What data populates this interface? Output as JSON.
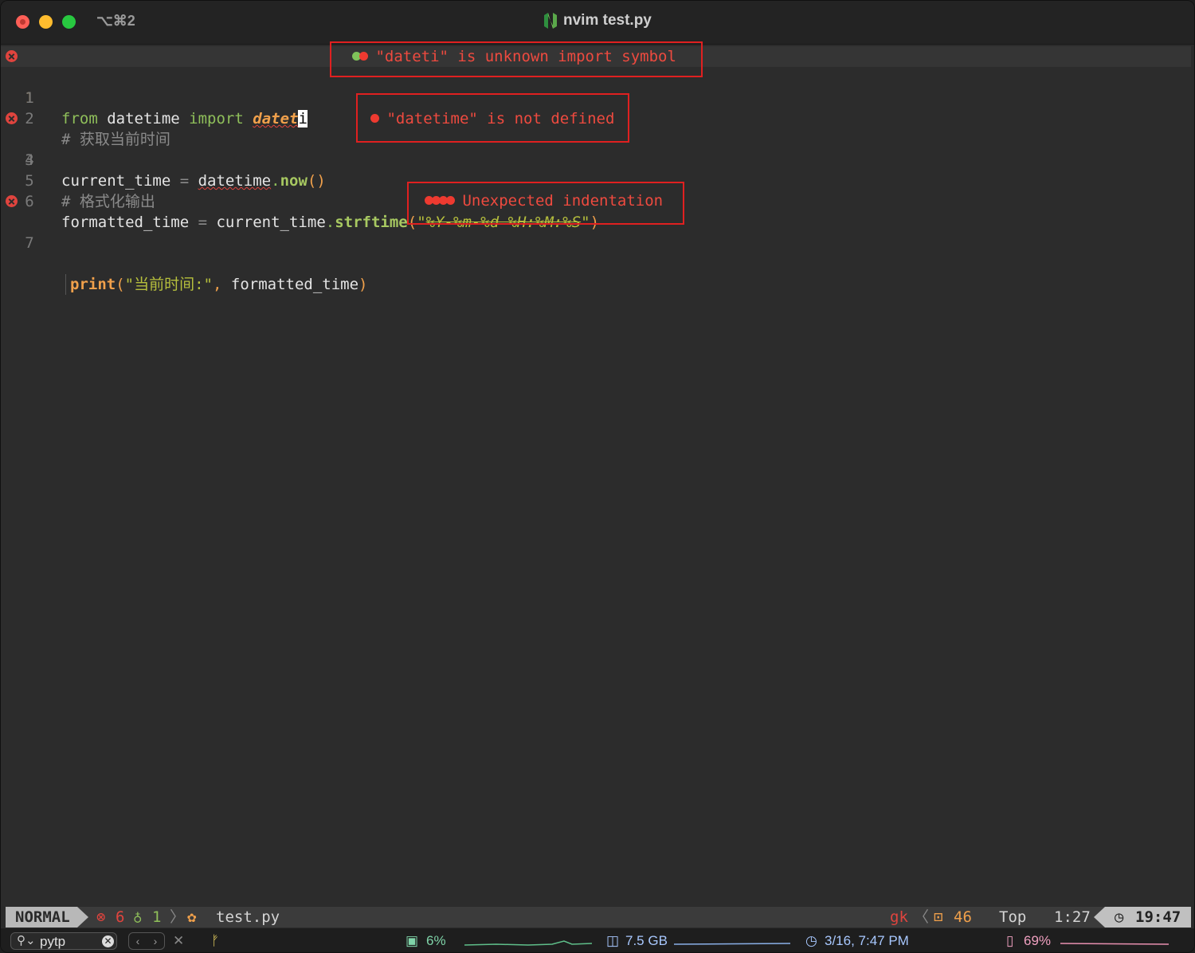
{
  "window": {
    "shortcut": "⌥⌘2",
    "title": "nvim test.py"
  },
  "editor": {
    "lines": [
      {
        "num": "1",
        "tokens": [
          "from",
          " datetime ",
          "import",
          " ",
          "datet",
          "i"
        ]
      },
      {
        "num": "1",
        "tokens": []
      },
      {
        "num": "2",
        "tokens": [
          "# 获取当前时间"
        ]
      },
      {
        "num": "3",
        "tokens": [
          "current_time",
          " = ",
          "datetime",
          ".",
          "now",
          "()"
        ]
      },
      {
        "num": "4",
        "tokens": []
      },
      {
        "num": "5",
        "tokens": [
          "# 格式化输出"
        ]
      },
      {
        "num": "6",
        "tokens": [
          "formatted_time",
          " = ",
          "current_time",
          ".",
          "strftime",
          "(",
          "\"",
          "%Y-%m-%d %H:%M:%S",
          "\"",
          ")"
        ]
      },
      {
        "num": "7",
        "tokens": [
          "print",
          "(",
          "\"当前时间:\"",
          ", ",
          "formatted_time",
          ")"
        ]
      }
    ],
    "diagnostics": [
      {
        "text": "\"dateti\" is unknown import symbol",
        "line": "1"
      },
      {
        "text": "\"datetime\" is not defined",
        "line": "3"
      },
      {
        "text": "Unexpected indentation",
        "line": "7"
      }
    ]
  },
  "statusline": {
    "mode": "NORMAL",
    "errors": "6",
    "hints": "1",
    "filename": "test.py",
    "branch": "gk",
    "count": "46",
    "position": "Top",
    "cursor": "1:27",
    "clock": "19:47"
  },
  "bottombar": {
    "search_value": "pytp",
    "cpu": "6%",
    "memory": "7.5 GB",
    "datetime": "3/16, 7:47 PM",
    "battery": "69%"
  },
  "colors": {
    "error": "#e0443e",
    "keyword": "#8fbf5a",
    "accent": "#f0a04b"
  }
}
